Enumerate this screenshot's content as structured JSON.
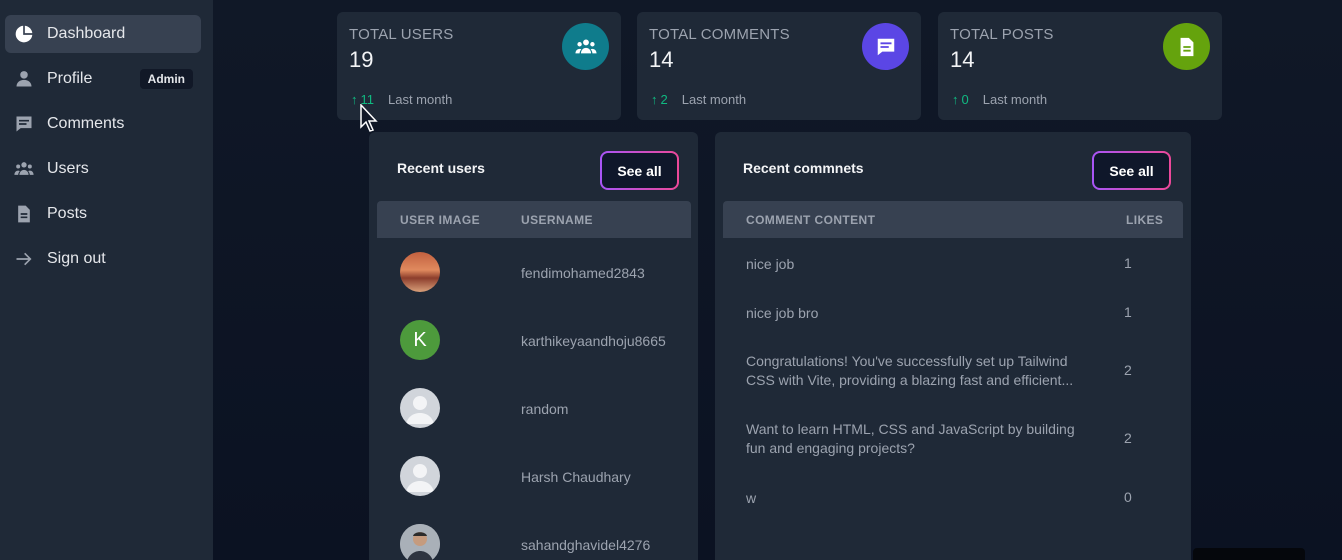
{
  "sidebar": {
    "items": [
      {
        "label": "Dashboard",
        "icon": "pie-chart-icon",
        "active": true
      },
      {
        "label": "Profile",
        "icon": "user-icon",
        "badge": "Admin"
      },
      {
        "label": "Comments",
        "icon": "comment-icon"
      },
      {
        "label": "Users",
        "icon": "users-icon"
      },
      {
        "label": "Posts",
        "icon": "document-icon"
      },
      {
        "label": "Sign out",
        "icon": "arrow-right-icon"
      }
    ]
  },
  "stats": [
    {
      "title": "TOTAL USERS",
      "value": "19",
      "trend": "11",
      "trend_label": "Last month",
      "icon": "users-group-icon",
      "color": "#0f7c8c"
    },
    {
      "title": "TOTAL COMMENTS",
      "value": "14",
      "trend": "2",
      "trend_label": "Last month",
      "icon": "comment-icon",
      "color": "#5b46e5"
    },
    {
      "title": "TOTAL POSTS",
      "value": "14",
      "trend": "0",
      "trend_label": "Last month",
      "icon": "document-icon",
      "color": "#65a30d"
    }
  ],
  "recent_users": {
    "title": "Recent users",
    "see_all": "See all",
    "headers": [
      "USER IMAGE",
      "USERNAME"
    ],
    "rows": [
      {
        "username": "fendimohamed2843",
        "avatar": "photo-landscape"
      },
      {
        "username": "karthikeyaandhoju8665",
        "avatar": "letter",
        "initial": "K",
        "color": "#4d9a3c"
      },
      {
        "username": "random",
        "avatar": "default"
      },
      {
        "username": "Harsh Chaudhary",
        "avatar": "default"
      },
      {
        "username": "sahandghavidel4276",
        "avatar": "photo-person"
      }
    ]
  },
  "recent_comments": {
    "title": "Recent commnets",
    "see_all": "See all",
    "headers": [
      "COMMENT CONTENT",
      "LIKES"
    ],
    "rows": [
      {
        "content": "nice job",
        "likes": "1"
      },
      {
        "content": "nice job bro",
        "likes": "1"
      },
      {
        "content": "Congratulations! You've successfully set up Tailwind CSS with Vite, providing a blazing fast and efficient...",
        "likes": "2"
      },
      {
        "content": "Want to learn HTML, CSS and JavaScript by building fun and engaging projects?",
        "likes": "2"
      },
      {
        "content": "w",
        "likes": "0"
      }
    ]
  }
}
